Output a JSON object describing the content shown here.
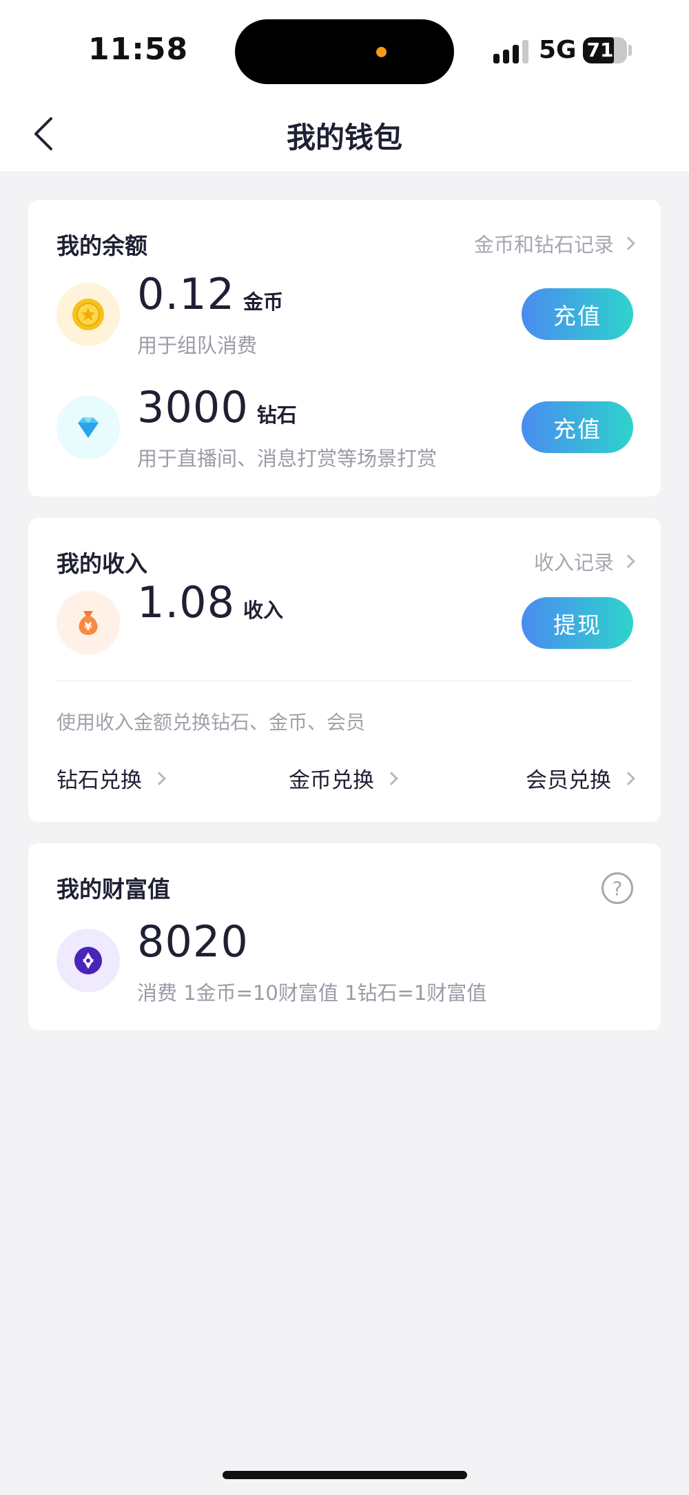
{
  "status_bar": {
    "time": "11:58",
    "network": "5G",
    "battery": "71",
    "battery_level": 0.71
  },
  "nav": {
    "title": "我的钱包",
    "back_icon": "chevron-left-icon"
  },
  "balance": {
    "title": "我的余额",
    "link": "金币和钻石记录",
    "coin": {
      "value": "0.12",
      "unit": "金币",
      "desc": "用于组队消费",
      "button": "充值",
      "icon": "gold-coin-icon"
    },
    "diamond": {
      "value": "3000",
      "unit": "钻石",
      "desc": "用于直播间、消息打赏等场景打赏",
      "button": "充值",
      "icon": "diamond-icon"
    }
  },
  "income": {
    "title": "我的收入",
    "link": "收入记录",
    "value": "1.08",
    "unit": "收入",
    "button": "提现",
    "icon": "money-bag-icon",
    "hint": "使用收入金额兑换钻石、金币、会员",
    "exchanges": [
      "钻石兑换",
      "金币兑换",
      "会员兑换"
    ]
  },
  "wealth": {
    "title": "我的财富值",
    "help_icon": "question-icon",
    "value": "8020",
    "desc": "消费 1金币=10财富值 1钻石=1财富值",
    "icon": "star-badge-icon"
  },
  "colors": {
    "accent_start": "#4a8cf0",
    "accent_end": "#2ed3cc",
    "background": "#f3f3f5"
  }
}
